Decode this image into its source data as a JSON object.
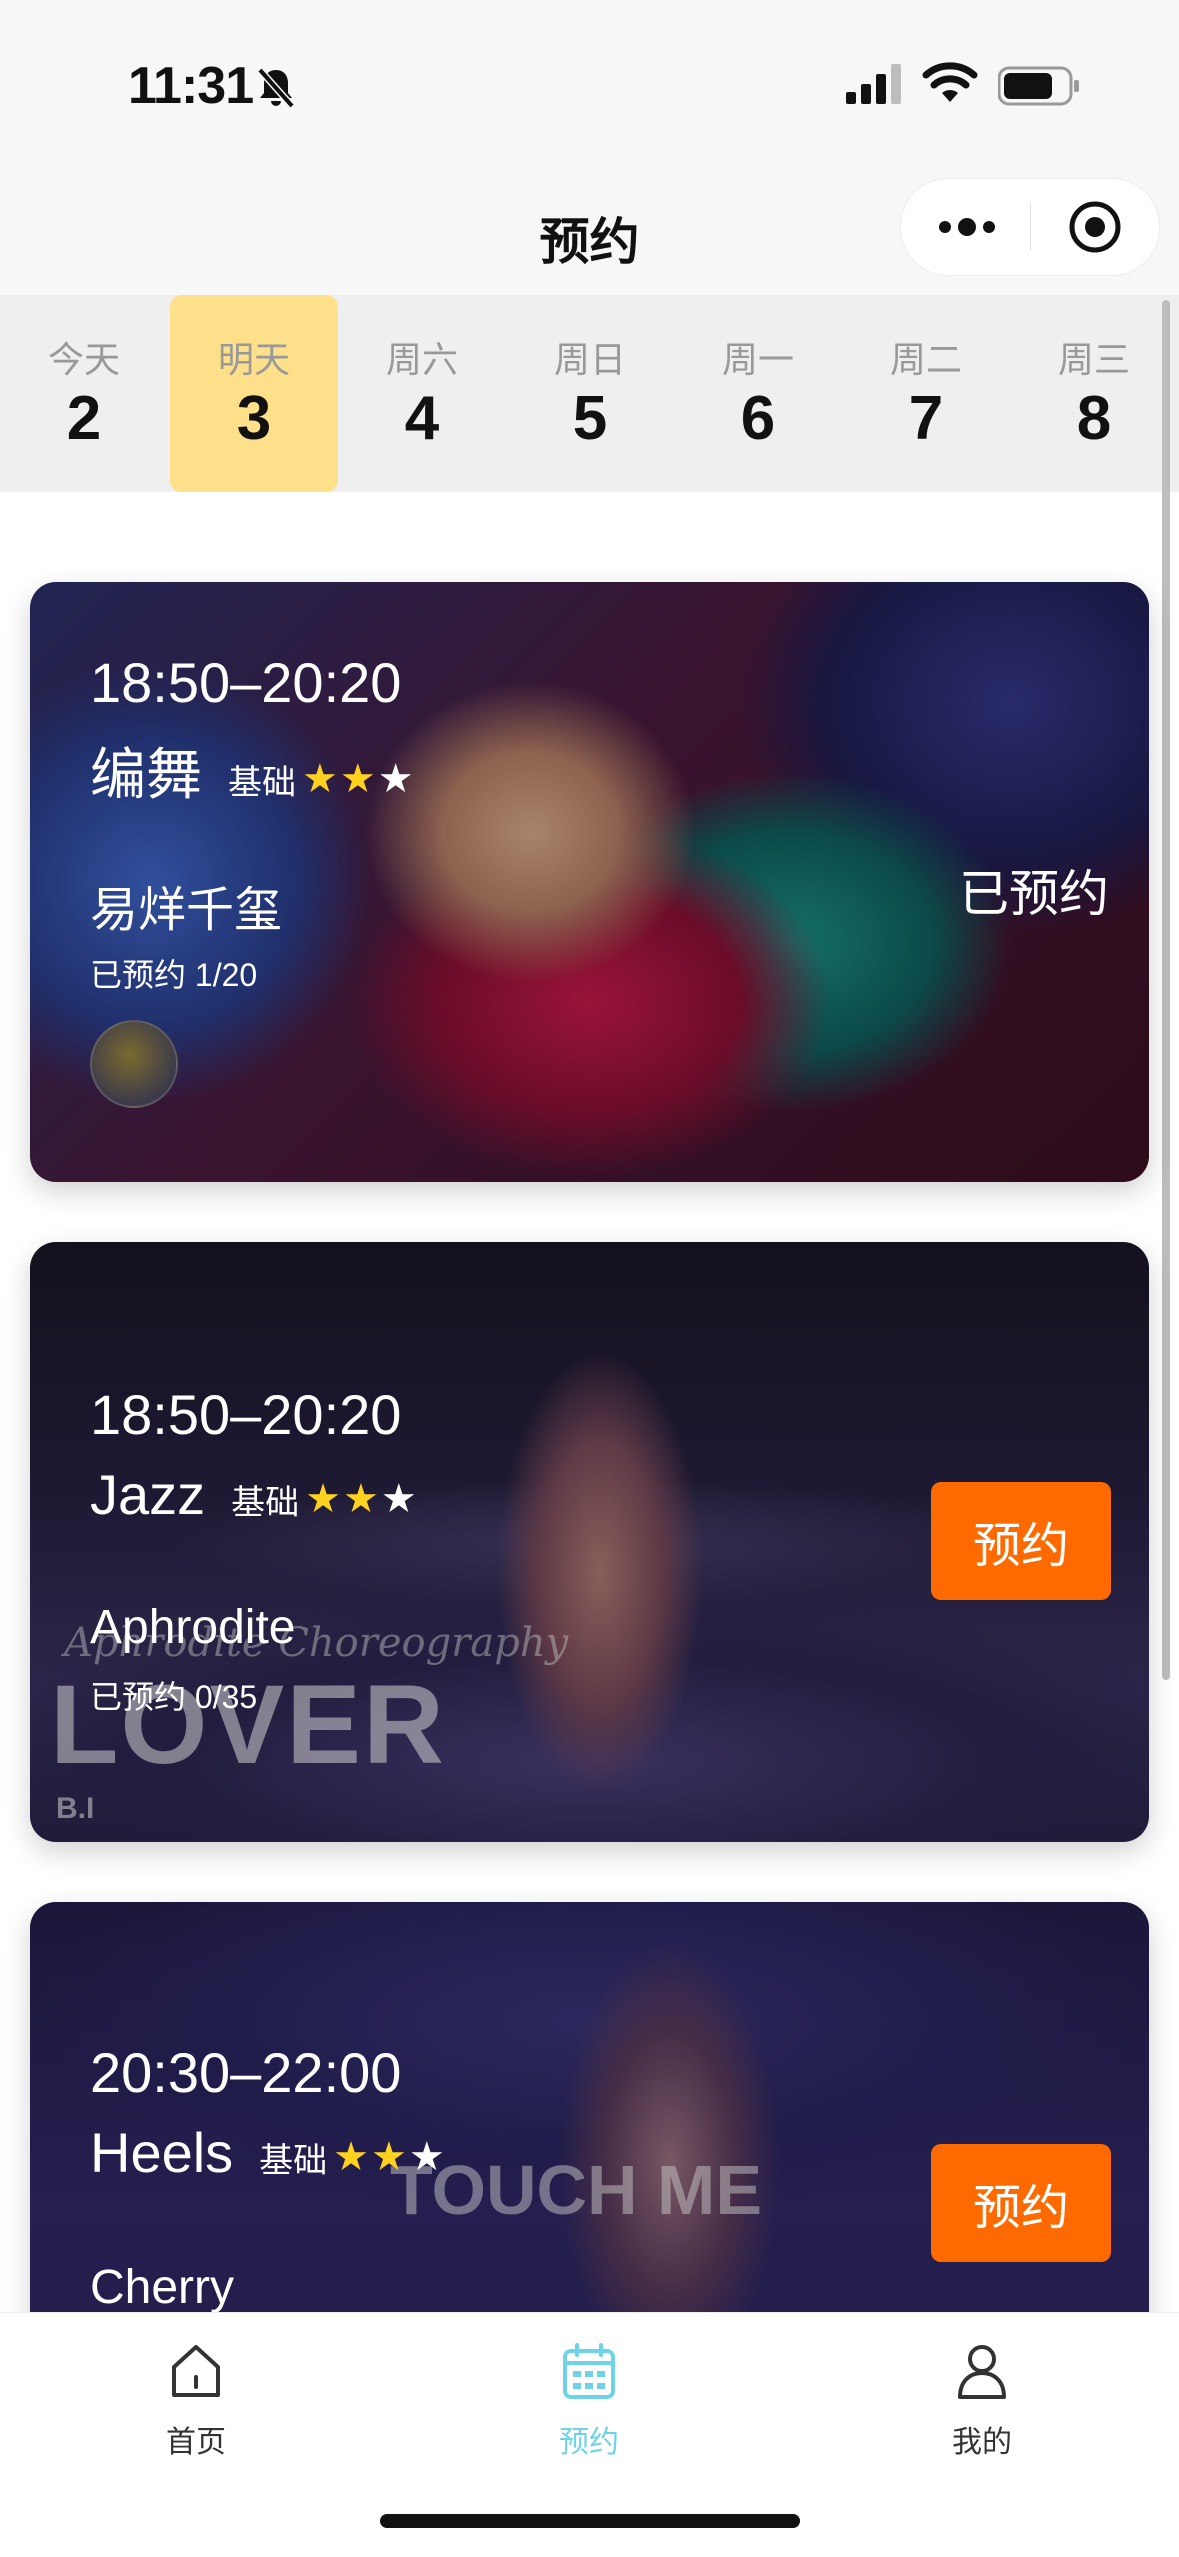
{
  "status_bar": {
    "time": "11:31"
  },
  "nav": {
    "title": "预约"
  },
  "dates": [
    {
      "week": "今天",
      "day": "2",
      "active": false
    },
    {
      "week": "明天",
      "day": "3",
      "active": true
    },
    {
      "week": "周六",
      "day": "4",
      "active": false
    },
    {
      "week": "周日",
      "day": "5",
      "active": false
    },
    {
      "week": "周一",
      "day": "6",
      "active": false
    },
    {
      "week": "周二",
      "day": "7",
      "active": false
    },
    {
      "week": "周三",
      "day": "8",
      "active": false
    }
  ],
  "classes": [
    {
      "time": "18:50–20:20",
      "name": "编舞",
      "level": "基础",
      "stars": "★★",
      "stars_off": "★",
      "teacher": "易烊千玺",
      "booked": "已预约 1/20",
      "status": "已预约"
    },
    {
      "time": "18:50–20:20",
      "name": "Jazz",
      "level": "基础",
      "stars": "★★",
      "stars_off": "★",
      "teacher": "Aphrodite",
      "booked": "已预约 0/35",
      "button": "预约",
      "watermark_big": "LOVER",
      "watermark_script": "Aphrodite Choreography",
      "watermark_small": "B.I"
    },
    {
      "time": "20:30–22:00",
      "name": "Heels",
      "level": "基础",
      "stars": "★★",
      "stars_off": "★",
      "teacher": "Cherry",
      "button": "预约",
      "watermark_big": "TOUCH ME"
    }
  ],
  "tabs": [
    {
      "label": "首页"
    },
    {
      "label": "预约"
    },
    {
      "label": "我的"
    }
  ],
  "colors": {
    "accent_orange": "#ff6a00",
    "active_date_bg": "#ffe08a",
    "active_tab": "#6fd3e8",
    "star": "#ffd21f"
  }
}
